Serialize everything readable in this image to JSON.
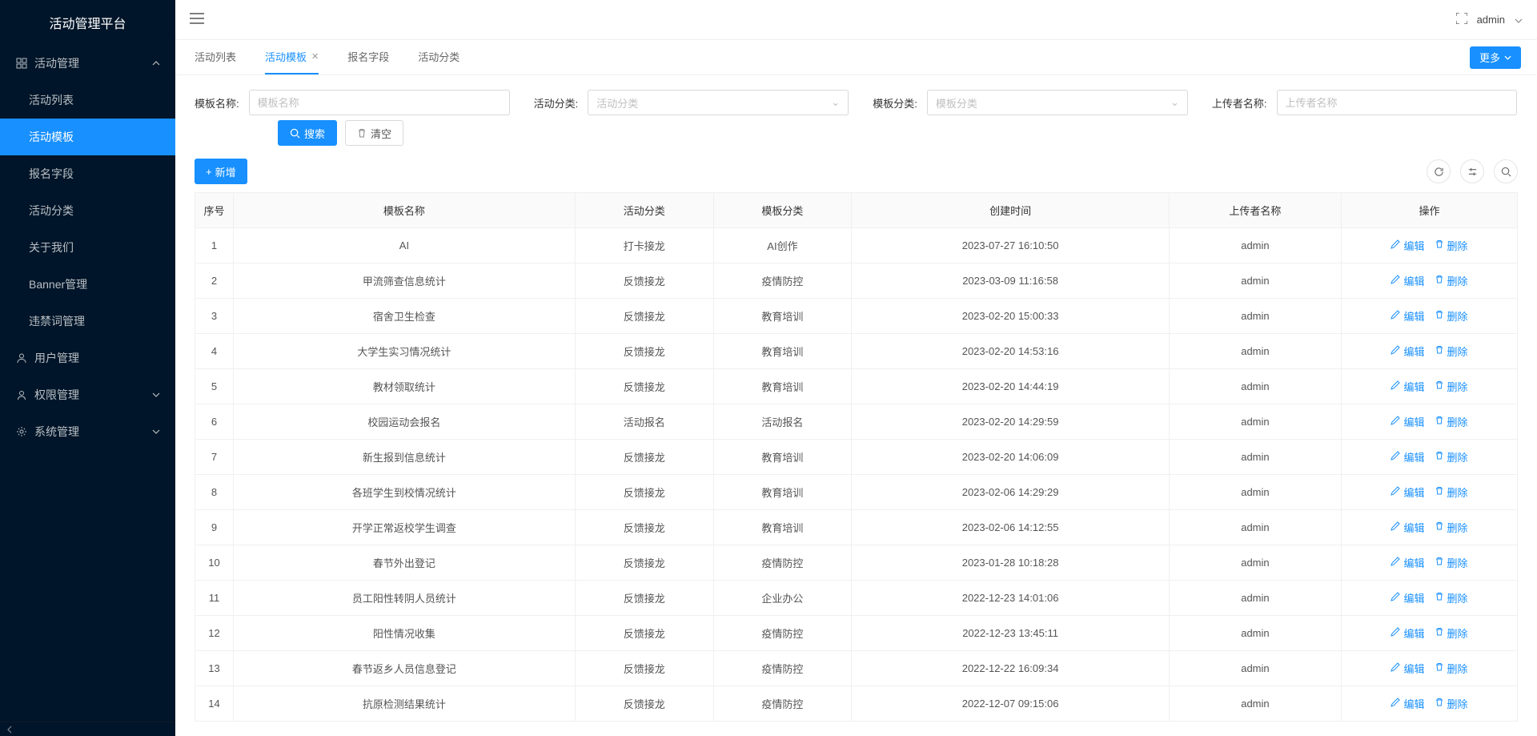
{
  "app_title": "活动管理平台",
  "sidebar": {
    "groups": [
      {
        "title": "活动管理",
        "icon": "grid",
        "expanded": true,
        "items": [
          {
            "label": "活动列表"
          },
          {
            "label": "活动模板",
            "active": true
          },
          {
            "label": "报名字段"
          },
          {
            "label": "活动分类"
          },
          {
            "label": "关于我们"
          },
          {
            "label": "Banner管理"
          },
          {
            "label": "违禁词管理"
          }
        ]
      },
      {
        "title": "用户管理",
        "icon": "user",
        "expanded": false,
        "items": []
      },
      {
        "title": "权限管理",
        "icon": "person",
        "expanded": false,
        "items": [],
        "has_chevron": true
      },
      {
        "title": "系统管理",
        "icon": "gear",
        "expanded": false,
        "items": [],
        "has_chevron": true
      }
    ]
  },
  "topbar": {
    "username": "admin"
  },
  "tabs": {
    "items": [
      {
        "label": "活动列表"
      },
      {
        "label": "活动模板",
        "active": true,
        "closable": true
      },
      {
        "label": "报名字段"
      },
      {
        "label": "活动分类"
      }
    ],
    "more": "更多"
  },
  "filters": {
    "name_label": "模板名称:",
    "name_placeholder": "模板名称",
    "cat1_label": "活动分类:",
    "cat1_placeholder": "活动分类",
    "cat2_label": "模板分类:",
    "cat2_placeholder": "模板分类",
    "uploader_label": "上传者名称:",
    "uploader_placeholder": "上传者名称",
    "search": "搜索",
    "clear": "清空"
  },
  "toolbar": {
    "add": "新增"
  },
  "table": {
    "headers": [
      "序号",
      "模板名称",
      "活动分类",
      "模板分类",
      "创建时间",
      "上传者名称",
      "操作"
    ],
    "edit": "编辑",
    "delete": "删除",
    "rows": [
      {
        "idx": 1,
        "name": "AI",
        "acat": "打卡接龙",
        "tcat": "AI创作",
        "created": "2023-07-27 16:10:50",
        "uploader": "admin"
      },
      {
        "idx": 2,
        "name": "甲流筛查信息统计",
        "acat": "反馈接龙",
        "tcat": "疫情防控",
        "created": "2023-03-09 11:16:58",
        "uploader": "admin"
      },
      {
        "idx": 3,
        "name": "宿舍卫生检查",
        "acat": "反馈接龙",
        "tcat": "教育培训",
        "created": "2023-02-20 15:00:33",
        "uploader": "admin"
      },
      {
        "idx": 4,
        "name": "大学生实习情况统计",
        "acat": "反馈接龙",
        "tcat": "教育培训",
        "created": "2023-02-20 14:53:16",
        "uploader": "admin"
      },
      {
        "idx": 5,
        "name": "教材领取统计",
        "acat": "反馈接龙",
        "tcat": "教育培训",
        "created": "2023-02-20 14:44:19",
        "uploader": "admin"
      },
      {
        "idx": 6,
        "name": "校园运动会报名",
        "acat": "活动报名",
        "tcat": "活动报名",
        "created": "2023-02-20 14:29:59",
        "uploader": "admin"
      },
      {
        "idx": 7,
        "name": "新生报到信息统计",
        "acat": "反馈接龙",
        "tcat": "教育培训",
        "created": "2023-02-20 14:06:09",
        "uploader": "admin"
      },
      {
        "idx": 8,
        "name": "各班学生到校情况统计",
        "acat": "反馈接龙",
        "tcat": "教育培训",
        "created": "2023-02-06 14:29:29",
        "uploader": "admin"
      },
      {
        "idx": 9,
        "name": "开学正常返校学生调查",
        "acat": "反馈接龙",
        "tcat": "教育培训",
        "created": "2023-02-06 14:12:55",
        "uploader": "admin"
      },
      {
        "idx": 10,
        "name": "春节外出登记",
        "acat": "反馈接龙",
        "tcat": "疫情防控",
        "created": "2023-01-28 10:18:28",
        "uploader": "admin"
      },
      {
        "idx": 11,
        "name": "员工阳性转阴人员统计",
        "acat": "反馈接龙",
        "tcat": "企业办公",
        "created": "2022-12-23 14:01:06",
        "uploader": "admin"
      },
      {
        "idx": 12,
        "name": "阳性情况收集",
        "acat": "反馈接龙",
        "tcat": "疫情防控",
        "created": "2022-12-23 13:45:11",
        "uploader": "admin"
      },
      {
        "idx": 13,
        "name": "春节返乡人员信息登记",
        "acat": "反馈接龙",
        "tcat": "疫情防控",
        "created": "2022-12-22 16:09:34",
        "uploader": "admin"
      },
      {
        "idx": 14,
        "name": "抗原检测结果统计",
        "acat": "反馈接龙",
        "tcat": "疫情防控",
        "created": "2022-12-07 09:15:06",
        "uploader": "admin"
      }
    ]
  }
}
